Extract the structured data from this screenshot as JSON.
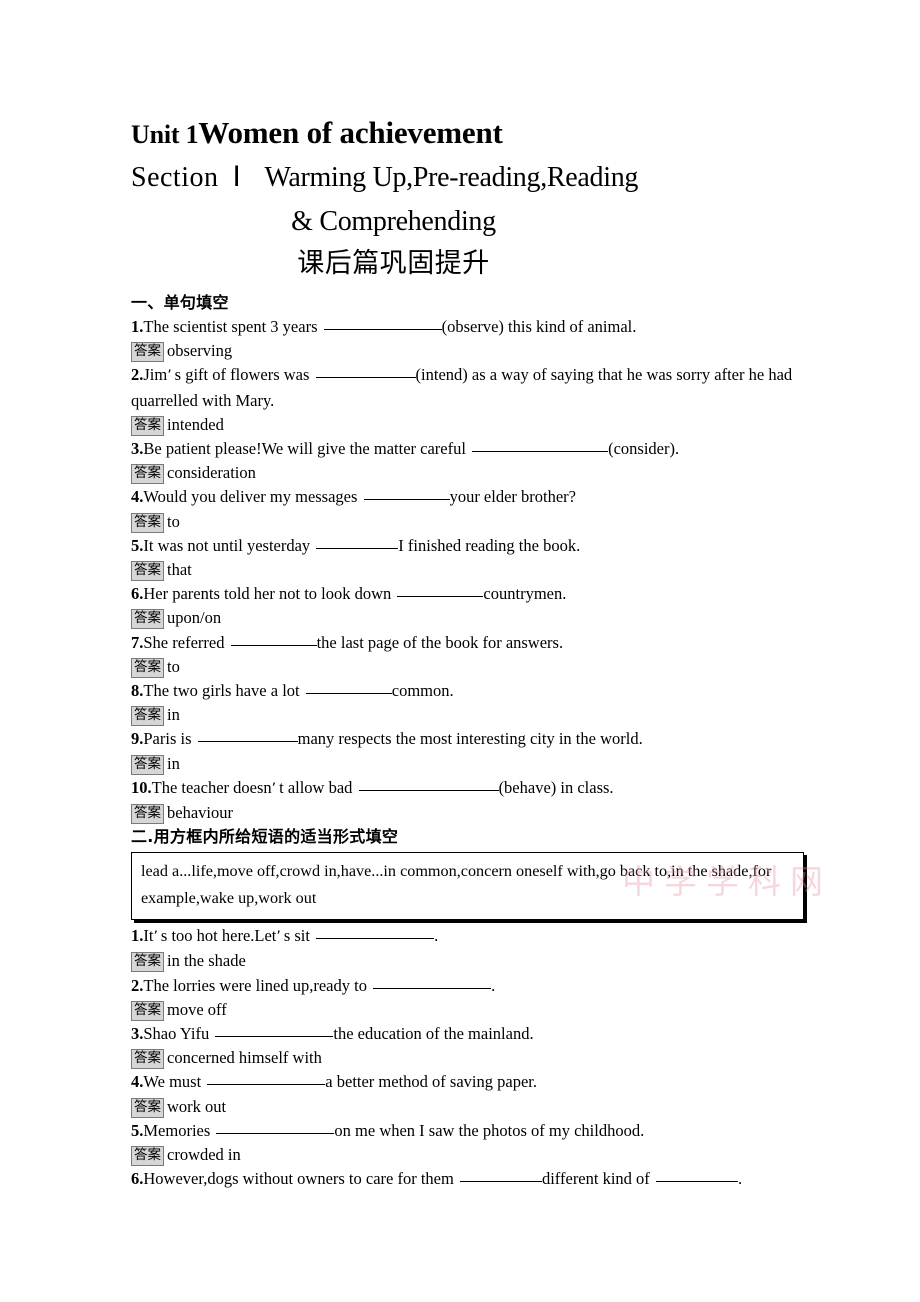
{
  "header": {
    "unit_no": "Unit 1",
    "unit_title": "Women of achievement",
    "section_word": "Section",
    "section_num": "Ⅰ",
    "section_title_line1": "Warming Up,Pre-reading,Reading",
    "section_title_line2": "& Comprehending",
    "subtitle_cn": "课后篇巩固提升"
  },
  "section_one": {
    "heading": "一、单句填空",
    "items": [
      {
        "num": "1.",
        "pre": "The scientist spent 3 years ",
        "blank_width": 118,
        "post": "(observe) this kind of animal.",
        "answer_label": "答案",
        "answer": "observing"
      },
      {
        "num": "2.",
        "pre_a": "Jim",
        "apostrophe": "’",
        "pre_b": "s gift of flowers was ",
        "blank_width": 100,
        "post": "(intend) as a way of saying that he was sorry after he had quarrelled with Mary.",
        "answer_label": "答案",
        "answer": "intended"
      },
      {
        "num": "3.",
        "pre": "Be patient please!We will give the matter careful ",
        "blank_width": 136,
        "post": "(consider).",
        "answer_label": "答案",
        "answer": "consideration"
      },
      {
        "num": "4.",
        "pre": "Would you deliver my messages ",
        "blank_width": 86,
        "post": "your elder brother?",
        "answer_label": "答案",
        "answer": "to"
      },
      {
        "num": "5.",
        "pre": "It was not until yesterday ",
        "blank_width": 82,
        "post": "I finished reading the book.",
        "answer_label": "答案",
        "answer": "that"
      },
      {
        "num": "6.",
        "pre": "Her parents told her not to look down ",
        "blank_width": 86,
        "post": "countrymen.",
        "answer_label": "答案",
        "answer": "upon/on"
      },
      {
        "num": "7.",
        "pre": "She referred ",
        "blank_width": 86,
        "post": "the last page of the book for answers.",
        "answer_label": "答案",
        "answer": "to"
      },
      {
        "num": "8.",
        "pre": "The two girls have a lot ",
        "blank_width": 86,
        "post": "common.",
        "answer_label": "答案",
        "answer": "in"
      },
      {
        "num": "9.",
        "pre": "Paris is ",
        "blank_width": 100,
        "post": "many respects the most interesting city in the world.",
        "answer_label": "答案",
        "answer": "in"
      },
      {
        "num": "10.",
        "pre_a": "The teacher doesn",
        "apostrophe": "’",
        "pre_b": "t allow bad ",
        "blank_width": 140,
        "post": "(behave) in class.",
        "answer_label": "答案",
        "answer": "behaviour"
      }
    ]
  },
  "section_two": {
    "heading": "二.用方框内所给短语的适当形式填空",
    "phrase_box": "lead a...life,move off,crowd in,have...in common,concern oneself with,go back to,in the shade,for example,wake up,work out",
    "items": [
      {
        "num": "1.",
        "pre_a": "It",
        "apostrophe": "’",
        "pre_b": "s too hot here.Let",
        "apostrophe2": "’",
        "pre_c": "s sit ",
        "blank_width": 118,
        "post": ".",
        "answer_label": "答案",
        "answer": "in the shade"
      },
      {
        "num": "2.",
        "pre": "The lorries were lined up,ready to ",
        "blank_width": 118,
        "post": ".",
        "answer_label": "答案",
        "answer": "move off"
      },
      {
        "num": "3.",
        "pre": "Shao Yifu ",
        "blank_width": 118,
        "post": "the education of the mainland.",
        "answer_label": "答案",
        "answer": "concerned himself with"
      },
      {
        "num": "4.",
        "pre": "We must ",
        "blank_width": 118,
        "post": "a better method of saving paper.",
        "answer_label": "答案",
        "answer": "work out"
      },
      {
        "num": "5.",
        "pre": "Memories ",
        "blank_width": 118,
        "post": "on me when I saw the photos of my childhood.",
        "answer_label": "答案",
        "answer": "crowded in"
      },
      {
        "num": "6.",
        "pre": "However,dogs without owners to care for them ",
        "blank_width": 82,
        "mid": "different kind of ",
        "blank_width_2": 82,
        "post": "."
      }
    ]
  },
  "watermark": {
    "line1": "中学学科网",
    "line2": ""
  }
}
